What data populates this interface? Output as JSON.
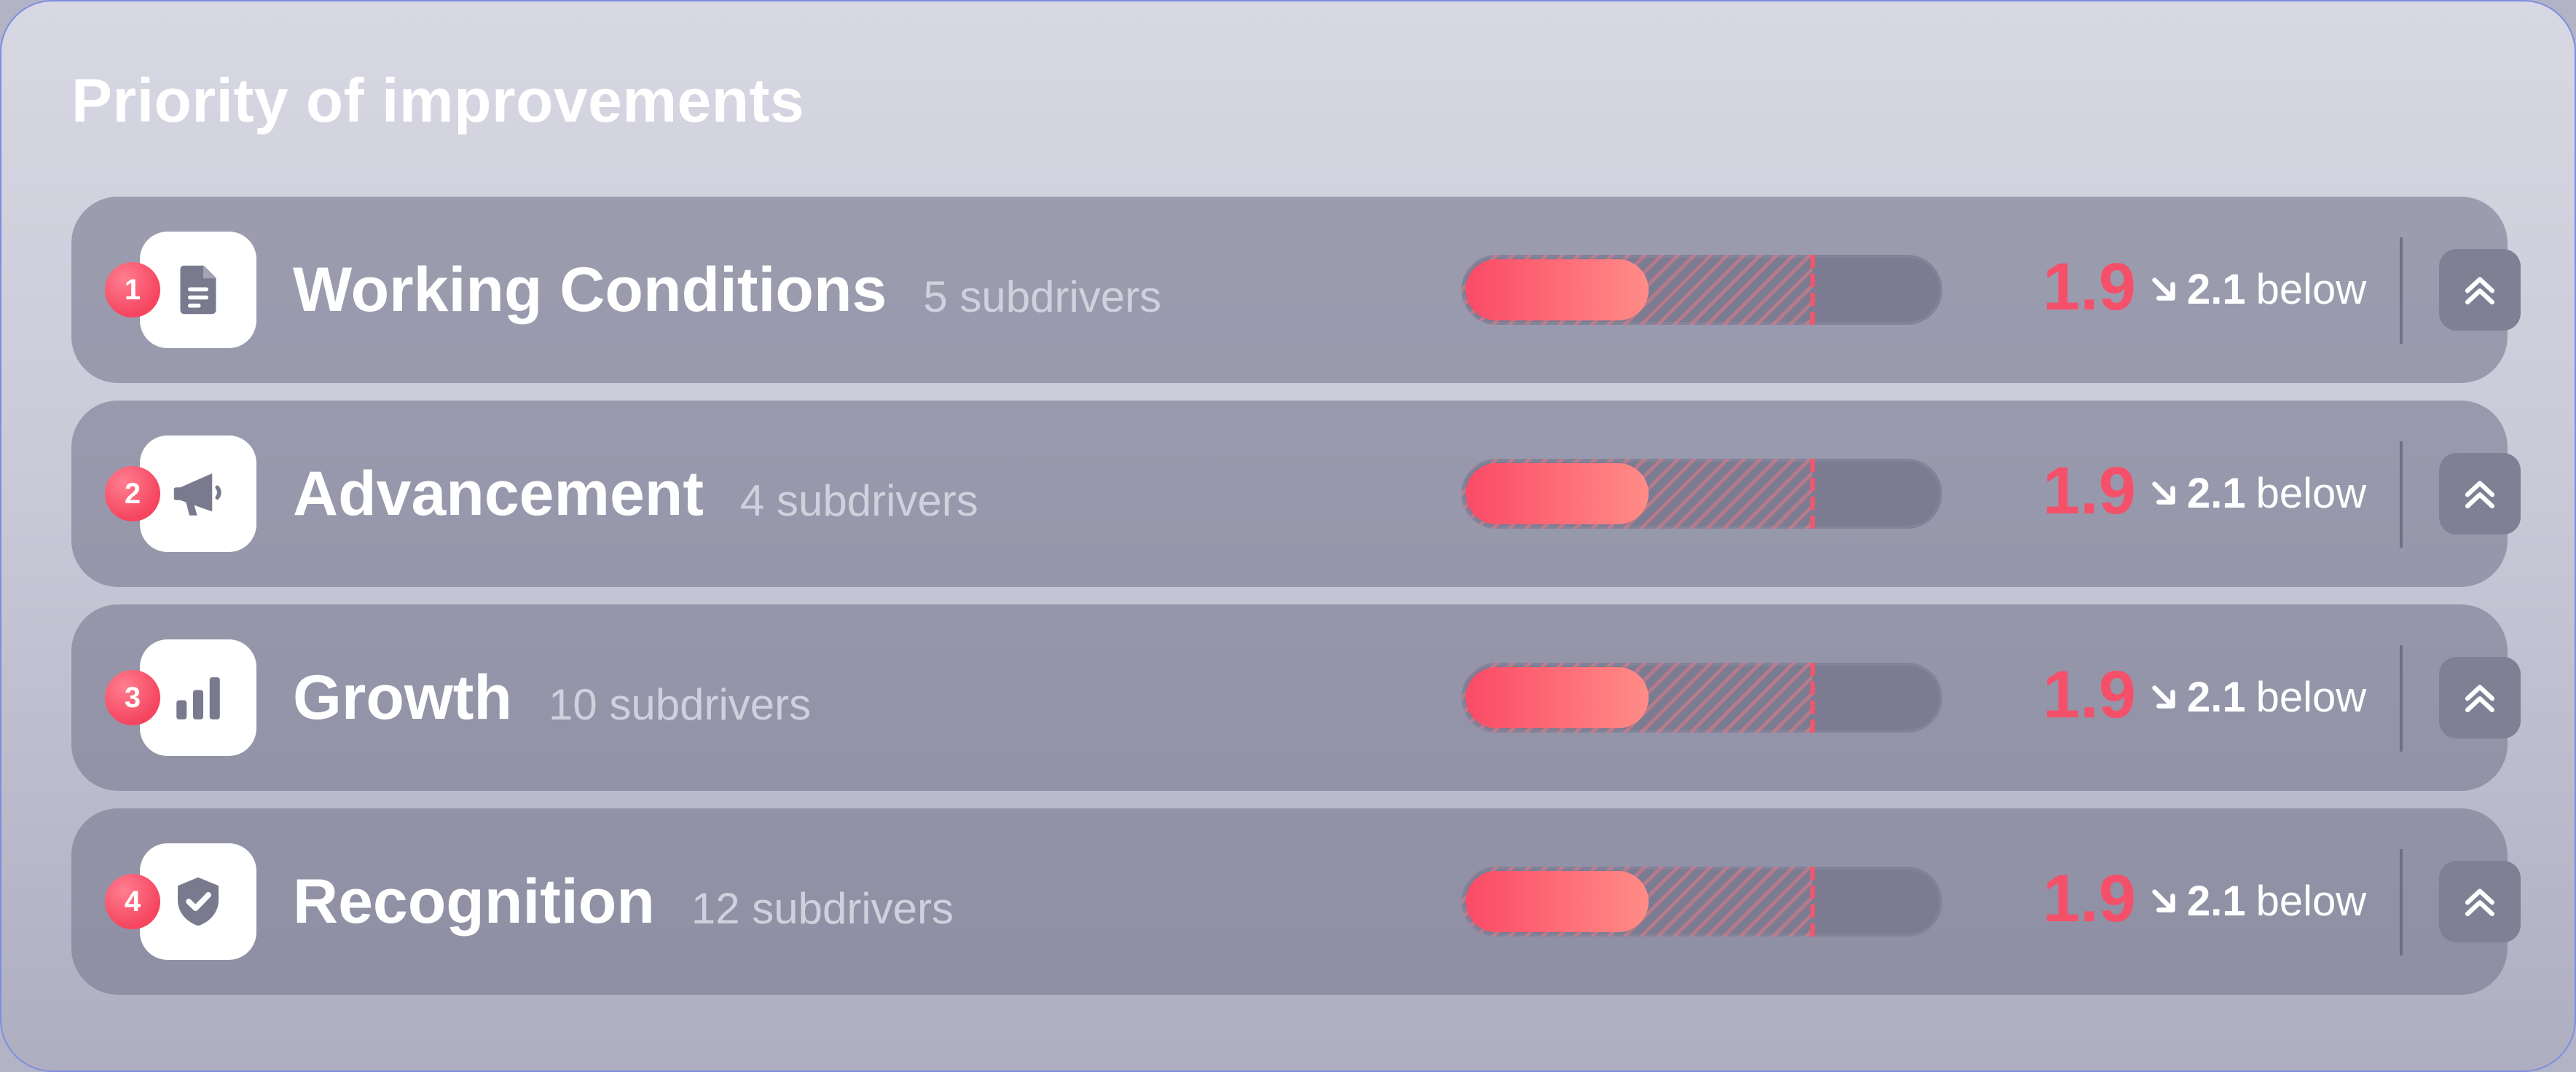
{
  "panel": {
    "title": "Priority of improvements"
  },
  "items": [
    {
      "rank": "1",
      "name": "Working Conditions",
      "subdrivers": "5 subdrivers",
      "icon": "document-icon",
      "score": "1.9",
      "score_fraction": 0.38,
      "benchmark_fraction": 0.73,
      "delta_value": "2.1",
      "delta_text": "below"
    },
    {
      "rank": "2",
      "name": "Advancement",
      "subdrivers": "4 subdrivers",
      "icon": "megaphone-icon",
      "score": "1.9",
      "score_fraction": 0.38,
      "benchmark_fraction": 0.73,
      "delta_value": "2.1",
      "delta_text": "below"
    },
    {
      "rank": "3",
      "name": "Growth",
      "subdrivers": "10 subdrivers",
      "icon": "bar-chart-icon",
      "score": "1.9",
      "score_fraction": 0.38,
      "benchmark_fraction": 0.73,
      "delta_value": "2.1",
      "delta_text": "below"
    },
    {
      "rank": "4",
      "name": "Recognition",
      "subdrivers": "12 subdrivers",
      "icon": "shield-check-icon",
      "score": "1.9",
      "score_fraction": 0.38,
      "benchmark_fraction": 0.73,
      "delta_value": "2.1",
      "delta_text": "below"
    }
  ],
  "colors": {
    "accent_red": "#f5506a",
    "icon_gray": "#7a7a8e",
    "row_background": "#8e8ea4"
  }
}
